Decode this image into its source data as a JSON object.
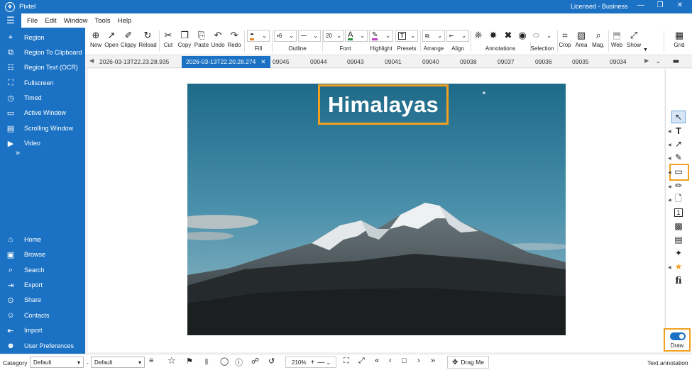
{
  "app": {
    "title": "Pixtel",
    "license": "Licensed - Business",
    "window_controls": [
      "—",
      "❐",
      "✕"
    ]
  },
  "menu": [
    "File",
    "Edit",
    "Window",
    "Tools",
    "Help"
  ],
  "sidebar": {
    "top": [
      {
        "label": "Region",
        "icon": "crosshair-icon",
        "glyph": "⌖"
      },
      {
        "label": "Region To Clipboard",
        "icon": "clipboard-icon",
        "glyph": "⧉"
      },
      {
        "label": "Region Text (OCR)",
        "icon": "ocr-icon",
        "glyph": "☷"
      },
      {
        "label": "Fullscreen",
        "icon": "fullscreen-icon",
        "glyph": "⛶"
      },
      {
        "label": "Timed",
        "icon": "timer-icon",
        "glyph": "◷"
      },
      {
        "label": "Active Window",
        "icon": "window-icon",
        "glyph": "▭"
      },
      {
        "label": "Scrolling Window",
        "icon": "scroll-icon",
        "glyph": "▤"
      },
      {
        "label": "Video",
        "icon": "video-icon",
        "glyph": "▶"
      }
    ],
    "more": "»",
    "bottom": [
      {
        "label": "Home",
        "icon": "home-icon",
        "glyph": "⌂"
      },
      {
        "label": "Browse",
        "icon": "folder-icon",
        "glyph": "▣"
      },
      {
        "label": "Search",
        "icon": "search-icon",
        "glyph": "⌕"
      },
      {
        "label": "Export",
        "icon": "export-icon",
        "glyph": "⇥"
      },
      {
        "label": "Share",
        "icon": "share-icon",
        "glyph": "⊙"
      },
      {
        "label": "Contacts",
        "icon": "contacts-icon",
        "glyph": "☺"
      },
      {
        "label": "Import",
        "icon": "import-icon",
        "glyph": "⇤"
      },
      {
        "label": "User Preferences",
        "icon": "user-icon",
        "glyph": "☻"
      }
    ]
  },
  "toolbar": {
    "file_buttons": [
      {
        "label": "New",
        "icon": "new-icon",
        "glyph": "⊕"
      },
      {
        "label": "Open",
        "icon": "open-icon",
        "glyph": "↗"
      },
      {
        "label": "Clippy",
        "icon": "paperclip-icon",
        "glyph": "✐"
      },
      {
        "label": "Reload",
        "icon": "reload-icon",
        "glyph": "↻"
      }
    ],
    "edit_buttons": [
      {
        "label": "Cut",
        "icon": "scissors-icon",
        "glyph": "✂"
      },
      {
        "label": "Copy",
        "icon": "copy-icon",
        "glyph": "❐"
      },
      {
        "label": "Paste",
        "icon": "paste-icon",
        "glyph": "⎘"
      },
      {
        "label": "Undo",
        "icon": "undo-icon",
        "glyph": "↶"
      },
      {
        "label": "Redo",
        "icon": "redo-icon",
        "glyph": "↷"
      }
    ],
    "fill_label": "Fill",
    "fill_color": "#e8811f",
    "outline_label": "Outline",
    "outline_width": "6",
    "font_label": "Font",
    "font_size": "20",
    "font_color": "#2e8b3a",
    "highlight_label": "Highlight",
    "highlight_color": "#c040c0",
    "presets_label": "Presets",
    "arrange_label": "Arrange",
    "align_label": "Align",
    "annotations_label": "Annotations",
    "selection_label": "Selection",
    "right_buttons": [
      {
        "label": "Crop",
        "icon": "crop-icon",
        "glyph": "⌗"
      },
      {
        "label": "Area",
        "icon": "area-icon",
        "glyph": "▧"
      },
      {
        "label": "Mag.",
        "icon": "magnifier-icon",
        "glyph": "⌕"
      },
      {
        "label": "Web",
        "icon": "web-icon",
        "glyph": "⬒"
      },
      {
        "label": "Show",
        "icon": "expand-icon",
        "glyph": "⤢"
      }
    ],
    "grid_label": "Grid"
  },
  "tabs": {
    "items": [
      "2026-03-13T22.23.28.935",
      "2026-03-13T22.20.28.274",
      "09045",
      "09044",
      "09043",
      "09041",
      "09040",
      "09038",
      "09037",
      "09036",
      "09035",
      "09034"
    ],
    "active_index": 1,
    "close_glyph": "✕"
  },
  "canvas": {
    "annotation_text": "Himalayas",
    "annotation_color": "#f0a020"
  },
  "palette": {
    "draw_label": "Draw",
    "draw_enabled": true
  },
  "status": {
    "category_label": "Category",
    "category_value": "Default",
    "separator": "-",
    "preset_value": "Default",
    "zoom": "210%",
    "drag_label": "Drag Me",
    "right_text": "Text annotation"
  }
}
